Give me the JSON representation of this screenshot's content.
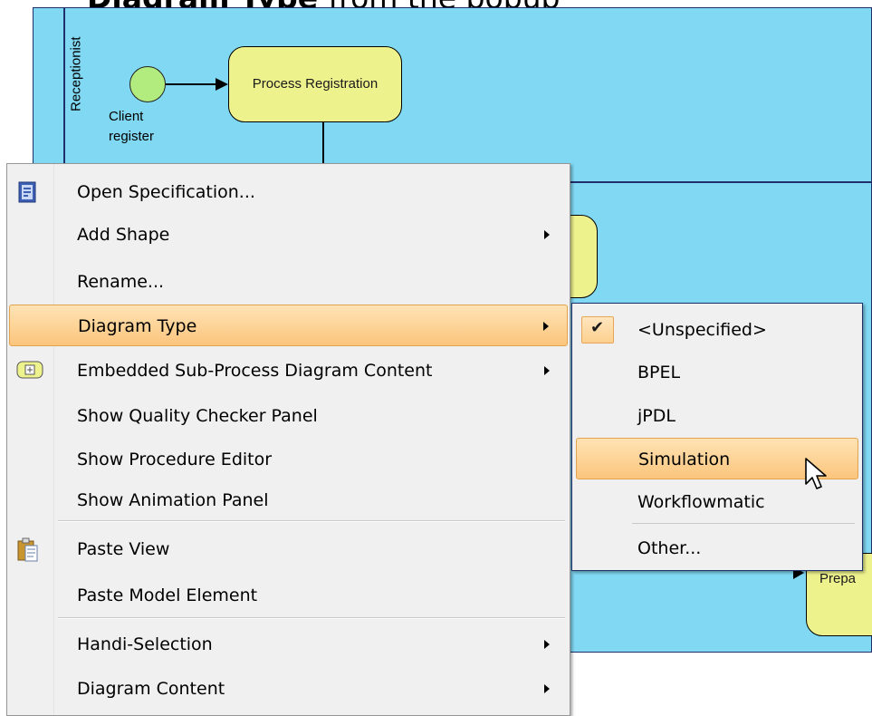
{
  "header": {
    "title_bold": "Diagram Type",
    "title_rest": "from the popup"
  },
  "diagram": {
    "lane_label": "Receptionist",
    "start_event_label": "Client register",
    "task1_label": "Process Registration",
    "task3_label": "Prepa"
  },
  "context_menu": {
    "items": [
      {
        "label": "Open Specification...",
        "icon": "specification-icon"
      },
      {
        "label": "Add Shape",
        "has_submenu": true
      },
      {
        "label": "Rename..."
      },
      {
        "label": "Diagram Type",
        "has_submenu": true,
        "highlighted": true
      },
      {
        "label": "Embedded Sub-Process Diagram Content",
        "icon": "sub-process-icon",
        "has_submenu": true
      },
      {
        "label": "Show Quality Checker Panel"
      },
      {
        "label": "Show Procedure Editor"
      },
      {
        "label": "Show Animation Panel"
      },
      {
        "label": "Paste View",
        "icon": "clipboard-icon"
      },
      {
        "label": "Paste Model Element"
      },
      {
        "label": "Handi-Selection",
        "has_submenu": true
      },
      {
        "label": "Diagram Content",
        "has_submenu": true
      }
    ]
  },
  "diagram_type_submenu": {
    "items": [
      {
        "label": "<Unspecified>",
        "checked": true
      },
      {
        "label": "BPEL"
      },
      {
        "label": "jPDL"
      },
      {
        "label": "Simulation",
        "highlighted": true
      },
      {
        "label": "Workflowmatic"
      },
      {
        "label": "Other..."
      }
    ],
    "check_glyph": "✔"
  },
  "colors": {
    "canvas": "#80d8f2",
    "task_fill": "#eef28d",
    "start_event_fill": "#b2ec7f",
    "menu_bg": "#f0f0f0",
    "highlight": "#fbc57d"
  }
}
